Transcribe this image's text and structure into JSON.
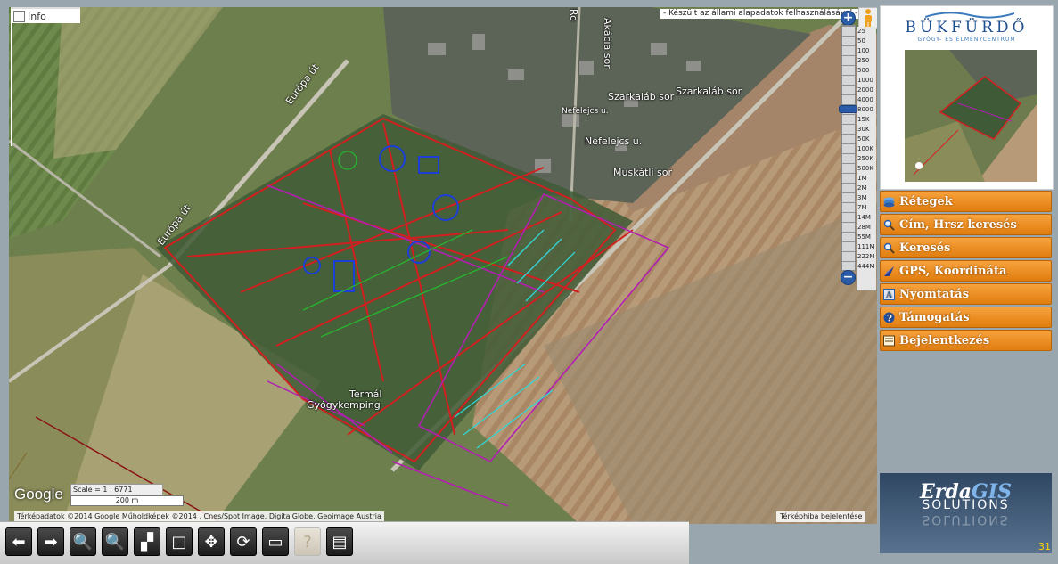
{
  "info": {
    "label": "Info"
  },
  "attribution_top": "- Készült az állami alapadatok felhasználásával -",
  "map_labels": {
    "europa_ut_1": "Európa út",
    "europa_ut_2": "Európa út",
    "akacia_sor": "Akácia sor",
    "szarkalab_sor_1": "Szarkaláb sor",
    "szarkalab_sor_2": "Szarkaláb sor",
    "nefelejcs_u_1": "Nefelejcs u.",
    "nefelejcs_u_2": "Nefelejcs u.",
    "muskatli_sor": "Muskátli sor",
    "termal": "Termál",
    "gyogykemping": "Gyógykemping",
    "ro": "Ro"
  },
  "zoom": {
    "plus": "+",
    "minus": "−",
    "scales": [
      "25",
      "50",
      "100",
      "250",
      "500",
      "1000",
      "2000",
      "4000",
      "8000",
      "15K",
      "30K",
      "50K",
      "100K",
      "250K",
      "500K",
      "1M",
      "2M",
      "3M",
      "7M",
      "14M",
      "28M",
      "55M",
      "111M",
      "222M",
      "444M"
    ]
  },
  "google_logo": "Google",
  "scale_text": "Scale = 1 : 6771",
  "scale_bar": "200 m",
  "copyright": "Térképadatok ©2014 Google Műholdképek ©2014 , Cnes/Spot Image, DigitalGlobe, Geoimage Austria",
  "report_error": "Térképhiba bejelentése",
  "logo": {
    "title": "BÜKFÜRDŐ",
    "subtitle": "GYÓGY- ÉS ÉLMÉNYCENTRUM"
  },
  "menu": [
    {
      "label": "Rétegek",
      "icon": "layers-icon"
    },
    {
      "label": "Cím, Hrsz keresés",
      "icon": "magnifier-icon"
    },
    {
      "label": "Keresés",
      "icon": "magnifier-icon"
    },
    {
      "label": "GPS, Koordináta",
      "icon": "gps-icon"
    },
    {
      "label": "Nyomtatás",
      "icon": "print-icon"
    },
    {
      "label": "Támogatás",
      "icon": "help-icon"
    },
    {
      "label": "Bejelentkezés",
      "icon": "login-icon"
    }
  ],
  "erda": {
    "name_a": "Erda",
    "name_b": "GIS",
    "solutions": "SOLUTIONS"
  },
  "page_number": "31",
  "toolbar": [
    {
      "name": "back-button",
      "icon": "arrow-left-icon",
      "glyph": "⬅"
    },
    {
      "name": "forward-button",
      "icon": "arrow-right-icon",
      "glyph": "➡"
    },
    {
      "name": "zoom-in-button",
      "icon": "zoom-in-icon",
      "glyph": "🔍"
    },
    {
      "name": "zoom-out-button",
      "icon": "zoom-out-icon",
      "glyph": "🔍"
    },
    {
      "name": "zoom-box-button",
      "icon": "zoom-box-icon",
      "glyph": "▞"
    },
    {
      "name": "zoom-extent-button",
      "icon": "extent-icon",
      "glyph": "□"
    },
    {
      "name": "pan-button",
      "icon": "pan-icon",
      "glyph": "✥"
    },
    {
      "name": "refresh-button",
      "icon": "refresh-icon",
      "glyph": "⟳"
    },
    {
      "name": "measure-button",
      "icon": "ruler-icon",
      "glyph": "▭"
    },
    {
      "name": "identify-button",
      "icon": "identify-icon",
      "glyph": "?"
    },
    {
      "name": "document-button",
      "icon": "document-icon",
      "glyph": "▤"
    }
  ],
  "colors": {
    "menu_orange": "#f09025",
    "accent_blue": "#2a5ca8"
  }
}
